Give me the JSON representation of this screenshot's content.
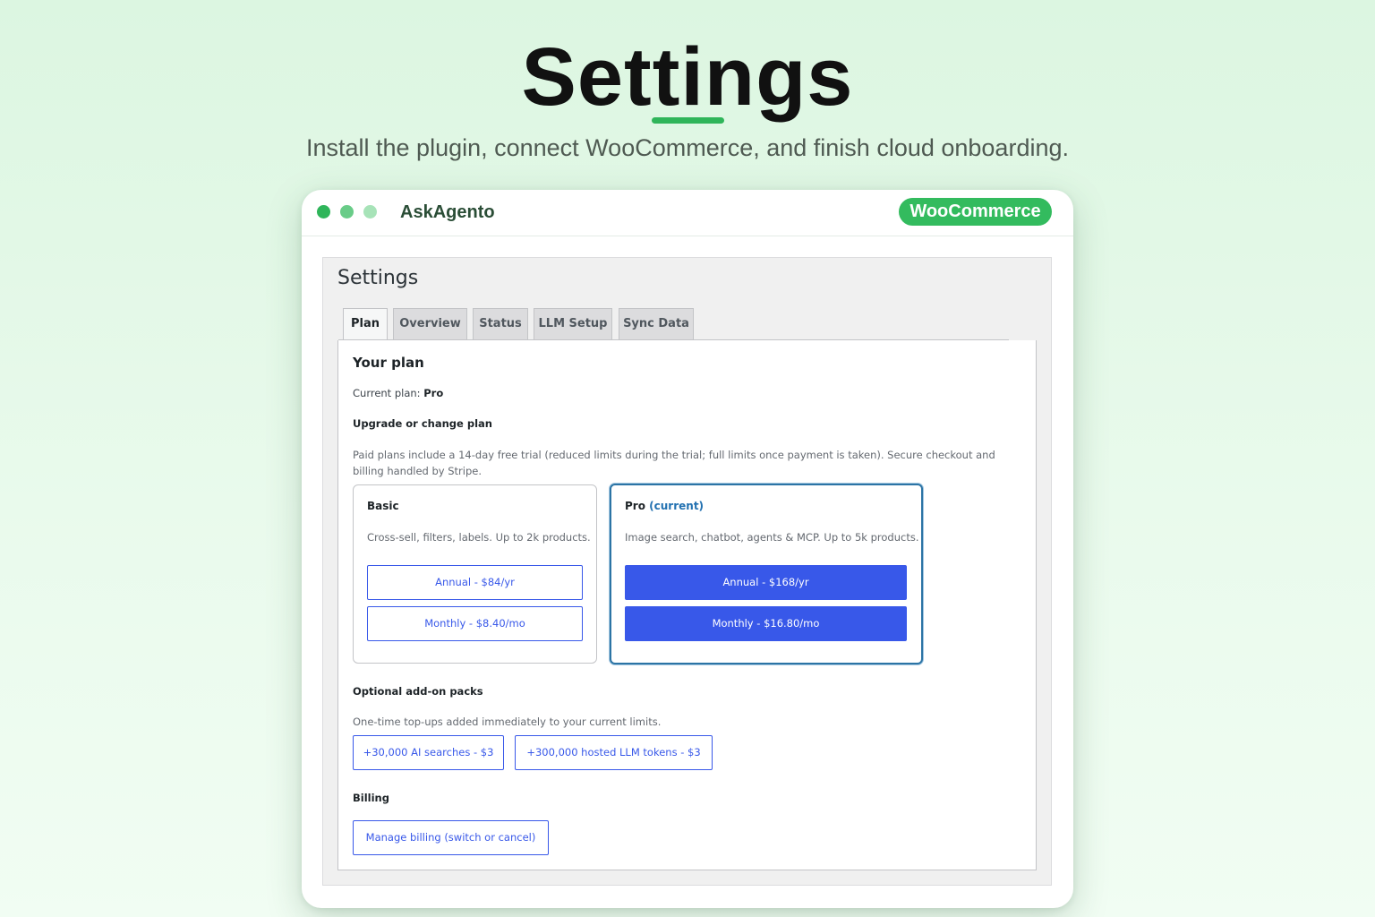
{
  "hero": {
    "title": "Settings",
    "subtitle": "Install the plugin, connect WooCommerce, and finish cloud onboarding."
  },
  "window": {
    "app_name": "AskAgento",
    "badge": "WooCommerce",
    "colors": {
      "accent_green": "#2fb55a",
      "wp_blue": "#3858e9"
    }
  },
  "settings": {
    "title": "Settings",
    "tabs": [
      {
        "label": "Plan",
        "active": true
      },
      {
        "label": "Overview",
        "active": false
      },
      {
        "label": "Status",
        "active": false
      },
      {
        "label": "LLM Setup",
        "active": false
      },
      {
        "label": "Sync Data",
        "active": false
      }
    ],
    "your_plan_heading": "Your plan",
    "current_plan_label": "Current plan:",
    "current_plan_value": "Pro",
    "upgrade_heading": "Upgrade or change plan",
    "trial_note": "Paid plans include a 14-day free trial (reduced limits during the trial; full limits once payment is taken). Secure checkout and billing handled by Stripe.",
    "plans": [
      {
        "name": "Basic",
        "current_tag": "",
        "description": "Cross-sell, filters, labels. Up to 2k products.",
        "annual": "Annual - $84/yr",
        "monthly": "Monthly - $8.40/mo"
      },
      {
        "name": "Pro",
        "current_tag": "(current)",
        "description": "Image search, chatbot, agents & MCP. Up to 5k products.",
        "annual": "Annual - $168/yr",
        "monthly": "Monthly - $16.80/mo"
      }
    ],
    "addons_heading": "Optional add-on packs",
    "addons_note": "One-time top-ups added immediately to your current limits.",
    "addons": [
      "+30,000 AI searches - $3",
      "+300,000 hosted LLM tokens - $3"
    ],
    "billing_heading": "Billing",
    "billing_button": "Manage billing (switch or cancel)"
  }
}
